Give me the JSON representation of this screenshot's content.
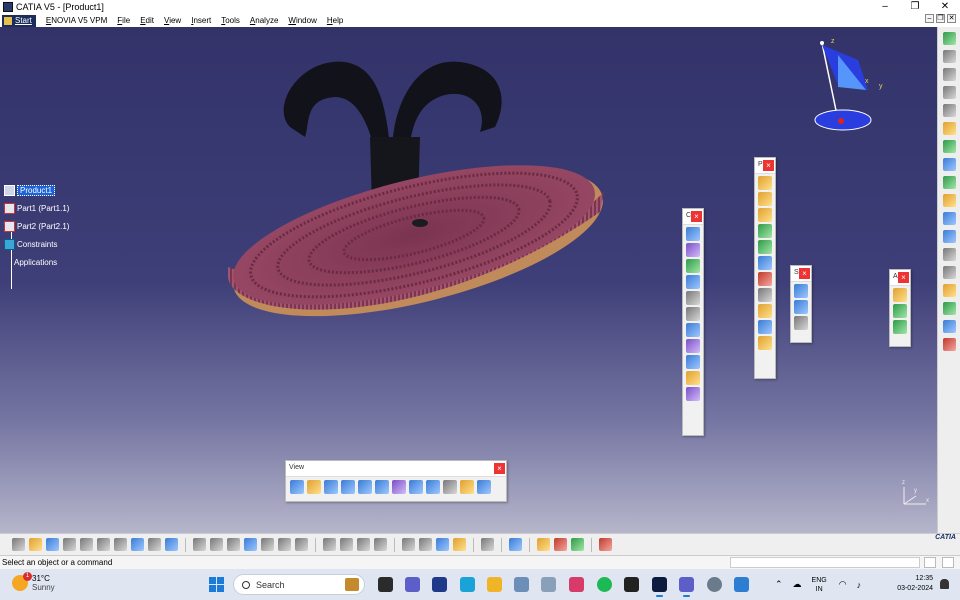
{
  "window": {
    "title": "CATIA V5 - [Product1]",
    "controls": [
      "–",
      "❐",
      "✕"
    ],
    "mdi_controls": [
      "–",
      "❐",
      "✕"
    ]
  },
  "menubar": {
    "start": "Start",
    "items": [
      "ENOVIA V5 VPM",
      "File",
      "Edit",
      "View",
      "Insert",
      "Tools",
      "Analyze",
      "Window",
      "Help"
    ]
  },
  "tree": {
    "root": "Product1",
    "children": [
      "Part1 (Part1.1)",
      "Part2 (Part2.1)",
      "Constraints"
    ],
    "applications": "Applications",
    "expander": "+"
  },
  "compass": {
    "x_label": "x",
    "y_label": "y",
    "z_label": "z"
  },
  "view_axis": {
    "x_label": "x",
    "y_label": "y",
    "z_label": "z"
  },
  "view_toolbar": {
    "title": "View",
    "close": "×",
    "icons": [
      "fly-mode-icon",
      "fit-all-icon",
      "pan-icon",
      "rotate-icon",
      "zoom-in-icon",
      "zoom-out-icon",
      "normal-view-icon",
      "multi-view-icon",
      "iso-view-icon",
      "shading-icon",
      "hide-show-icon",
      "swap-space-icon"
    ]
  },
  "floating_toolbars": [
    {
      "title": "C",
      "close": "×",
      "icon_count": 11
    },
    {
      "title": "P",
      "close": "×",
      "icon_count": 11
    },
    {
      "title": "S",
      "close": "×",
      "icon_count": 3
    },
    {
      "title": "A",
      "close": "×",
      "icon_count": 3
    }
  ],
  "colors": {
    "viewport_top": "#33336a",
    "viewport_bottom": "#b5b5cb",
    "model_bristles": "#8a3f58",
    "model_clip": "#15151c",
    "selection": "#1e63d6",
    "close_red": "#e33333"
  },
  "logo": "CATIA",
  "status": {
    "message": "Select an object or a command"
  },
  "taskbar": {
    "weather_temp": "31°C",
    "weather_cond": "Sunny",
    "weather_badge": "1",
    "search_label": "Search",
    "lang_line1": "ENG",
    "lang_line2": "IN",
    "time": "12:35",
    "date": "03-02-2024"
  }
}
